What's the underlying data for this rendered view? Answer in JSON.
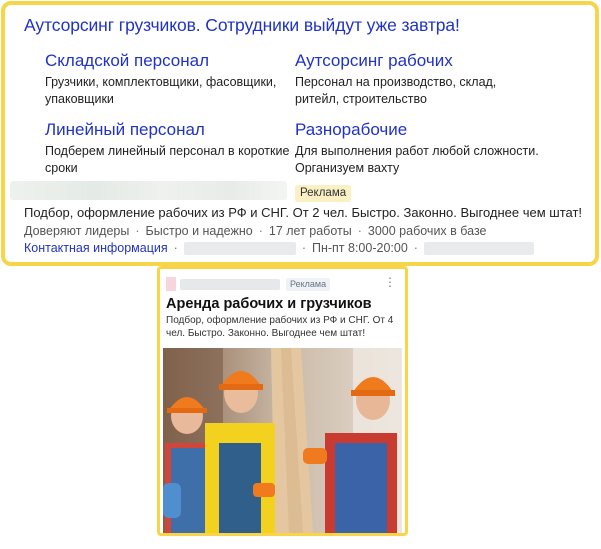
{
  "ad1": {
    "title": "Аутсорсинг грузчиков. Сотрудники выйдут уже завтра!",
    "sitelinks": [
      {
        "title": "Складской персонал",
        "desc": "Грузчики, комплектовщики, фасовщики, упаковщики"
      },
      {
        "title": "Аутсорсинг рабочих",
        "desc": "Персонал на производство, склад, ритейл, строительство"
      },
      {
        "title": "Линейный персонал",
        "desc": "Подберем линейный персонал в короткие сроки"
      },
      {
        "title": "Разнорабочие",
        "desc": "Для выполнения работ любой сложности. Организуем вахту"
      }
    ],
    "badge": "Реклама",
    "text": "Подбор, оформление рабочих из РФ и СНГ. От 2 чел. Быстро. Законно. Выгоднее чем штат!",
    "meta": [
      "Доверяют лидеры",
      "Быстро и надежно",
      "17 лет работы",
      "3000 рабочих в базе"
    ],
    "contacts_link": "Контактная информация",
    "hours": "Пн-пт 8:00-20:00"
  },
  "ad2": {
    "badge": "Реклама",
    "more_icon": "⋮",
    "title": "Аренда рабочих и грузчиков",
    "text": "Подбор, оформление рабочих из РФ и СНГ. От 4 чел. Быстро. Законно. Выгоднее чем штат!"
  },
  "colors": {
    "link": "#2033c5",
    "highlight_border": "#f7d54a",
    "badge_bg": "#fbefc4"
  }
}
